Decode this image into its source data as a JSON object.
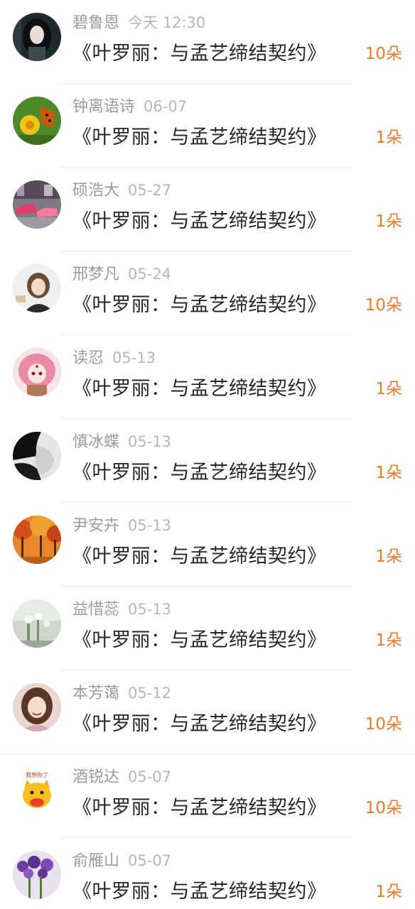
{
  "gift_list": {
    "items": [
      {
        "name": "碧鲁恩",
        "time": "今天 12:30",
        "gift": "《叶罗丽：与孟艺缔结契约》",
        "count": "10朵",
        "avatar_icon": "avatar-girl-dark-hair-icon"
      },
      {
        "name": "钟离语诗",
        "time": "06-07",
        "gift": "《叶罗丽：与孟艺缔结契约》",
        "count": "1朵",
        "avatar_icon": "avatar-butterfly-flower-icon"
      },
      {
        "name": "硕浩大",
        "time": "05-27",
        "gift": "《叶罗丽：与孟艺缔结契约》",
        "count": "1朵",
        "avatar_icon": "avatar-pink-cars-icon"
      },
      {
        "name": "邢梦凡",
        "time": "05-24",
        "gift": "《叶罗丽：与孟艺缔结契约》",
        "count": "10朵",
        "avatar_icon": "avatar-girl-portrait-icon"
      },
      {
        "name": "读忍",
        "time": "05-13",
        "gift": "《叶罗丽：与孟艺缔结契约》",
        "count": "1朵",
        "avatar_icon": "avatar-anime-pink-hair-icon"
      },
      {
        "name": "慎冰蝶",
        "time": "05-13",
        "gift": "《叶罗丽：与孟艺缔结契约》",
        "count": "1朵",
        "avatar_icon": "avatar-man-profile-bw-icon"
      },
      {
        "name": "尹安卉",
        "time": "05-13",
        "gift": "《叶罗丽：与孟艺缔结契约》",
        "count": "1朵",
        "avatar_icon": "avatar-autumn-trees-icon"
      },
      {
        "name": "益惜蕊",
        "time": "05-13",
        "gift": "《叶罗丽：与孟艺缔结契约》",
        "count": "1朵",
        "avatar_icon": "avatar-white-flowers-icon"
      },
      {
        "name": "本芳蔼",
        "time": "05-12",
        "gift": "《叶罗丽：与孟艺缔结契约》",
        "count": "10朵",
        "avatar_icon": "avatar-smiling-girl-icon"
      },
      {
        "name": "酒锐达",
        "time": "05-07",
        "gift": "《叶罗丽：与孟艺缔结契约》",
        "count": "10朵",
        "avatar_icon": "avatar-cartoon-cat-icon"
      },
      {
        "name": "俞雁山",
        "time": "05-07",
        "gift": "《叶罗丽：与孟艺缔结契约》",
        "count": "1朵",
        "avatar_icon": "avatar-lavender-flowers-icon"
      }
    ],
    "avatar_cartoon_text": "我想你了"
  },
  "colors": {
    "name": "#9b9b9b",
    "time": "#b7b7b7",
    "gift_title": "#262626",
    "count": "#f07a24",
    "divider": "#efefef"
  }
}
